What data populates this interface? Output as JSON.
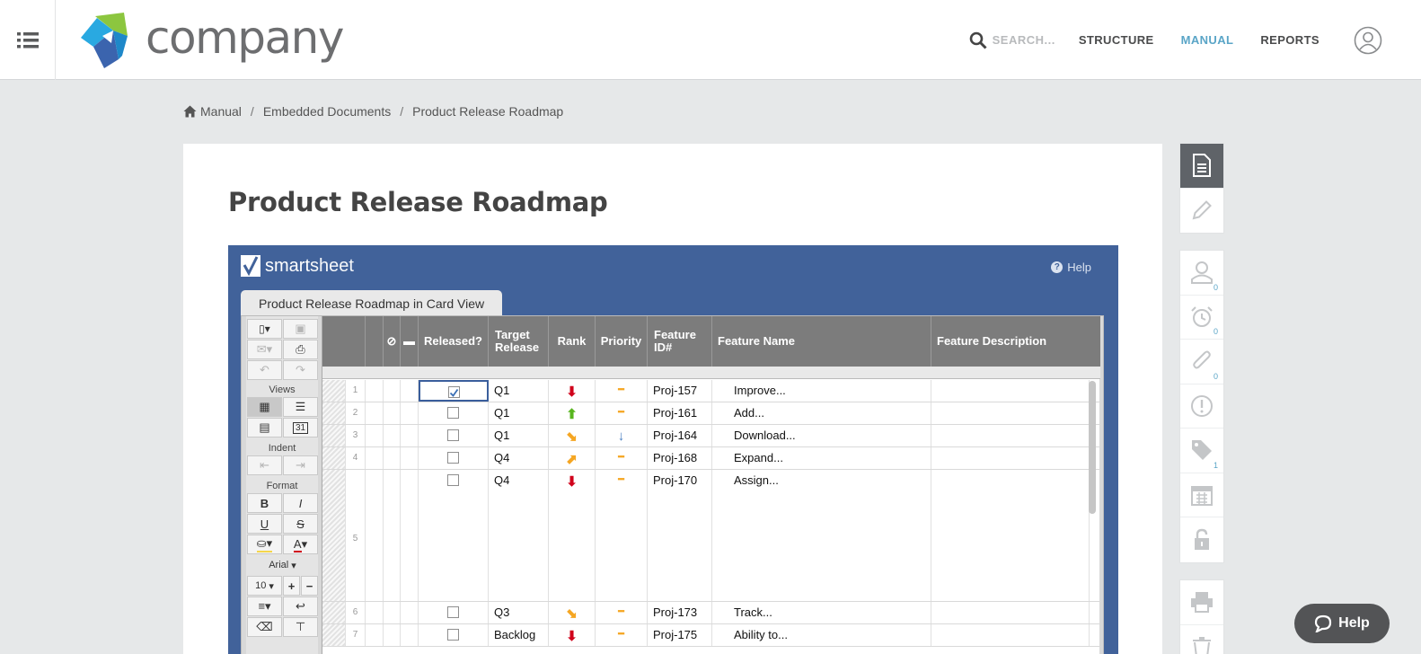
{
  "header": {
    "logo_text": "company",
    "search_label": "SEARCH...",
    "nav": [
      "STRUCTURE",
      "MANUAL",
      "REPORTS"
    ],
    "active_nav": "MANUAL",
    "accent_color": "#5aa5c7"
  },
  "breadcrumb": [
    "Manual",
    "Embedded Documents",
    "Product Release Roadmap"
  ],
  "page": {
    "title": "Product Release Roadmap"
  },
  "smartsheet": {
    "brand_prefix": "smart",
    "brand_suffix": "sheet",
    "help": "Help",
    "tab": "Product Release Roadmap in Card View",
    "toolbar": {
      "views_label": "Views",
      "indent_label": "Indent",
      "format_label": "Format",
      "bold": "B",
      "italic": "I",
      "underline": "U",
      "strike": "S",
      "font": "Arial",
      "size": "10",
      "plus": "+",
      "minus": "−",
      "calendar_day": "31"
    },
    "columns": [
      "Released?",
      "Target Release",
      "Rank",
      "Priority",
      "Feature ID#",
      "Feature Name",
      "Feature Description"
    ],
    "rows": [
      {
        "num": "1",
        "released": true,
        "release": "Q1",
        "rank": "down-red",
        "priority": "dash",
        "id": "Proj-157",
        "name": "Improve..."
      },
      {
        "num": "2",
        "released": false,
        "release": "Q1",
        "rank": "up-green",
        "priority": "dash",
        "id": "Proj-161",
        "name": "Add..."
      },
      {
        "num": "3",
        "released": false,
        "release": "Q1",
        "rank": "diag-down-orange",
        "priority": "down-blue",
        "id": "Proj-164",
        "name": "Download..."
      },
      {
        "num": "4",
        "released": false,
        "release": "Q4",
        "rank": "diag-up-orange",
        "priority": "dash",
        "id": "Proj-168",
        "name": "Expand..."
      },
      {
        "num": "5",
        "released": false,
        "release": "Q4",
        "rank": "down-red",
        "priority": "dash",
        "id": "Proj-170",
        "name": "Assign..."
      },
      {
        "num": "6",
        "released": false,
        "release": "Q3",
        "rank": "diag-down-orange",
        "priority": "dash",
        "id": "Proj-173",
        "name": "Track..."
      },
      {
        "num": "7",
        "released": false,
        "release": "Backlog",
        "rank": "down-red",
        "priority": "dash",
        "id": "Proj-175",
        "name": "Ability to..."
      }
    ]
  },
  "sidebar": {
    "group1": [
      "document-icon",
      "pencil-icon"
    ],
    "group2": [
      {
        "icon": "user-icon",
        "count": "0"
      },
      {
        "icon": "alarm-clock-icon",
        "count": "0"
      },
      {
        "icon": "paperclip-icon",
        "count": "0"
      },
      {
        "icon": "alert-icon",
        "count": ""
      },
      {
        "icon": "tag-icon",
        "count": "1"
      },
      {
        "icon": "calendar-icon",
        "count": ""
      },
      {
        "icon": "lock-icon",
        "count": ""
      }
    ],
    "group3": [
      "printer-icon",
      "trash-icon"
    ]
  },
  "help_widget": {
    "label": "Help"
  }
}
